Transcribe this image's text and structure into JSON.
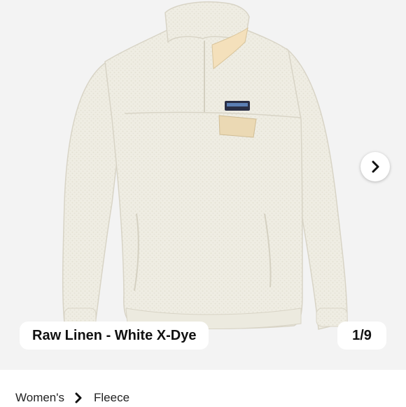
{
  "gallery": {
    "color_name": "Raw Linen - White X-Dye",
    "counter": "1/9",
    "next_icon": "chevron-right-icon",
    "brand_logo": "patagonia"
  },
  "breadcrumb": {
    "items": [
      "Women's",
      "Fleece"
    ],
    "separator_icon": "chevron-right-icon"
  },
  "colors": {
    "gallery_bg": "#f3f3f3",
    "fleece": "#f0eee4",
    "pocket_flap": "#ead8b2"
  }
}
